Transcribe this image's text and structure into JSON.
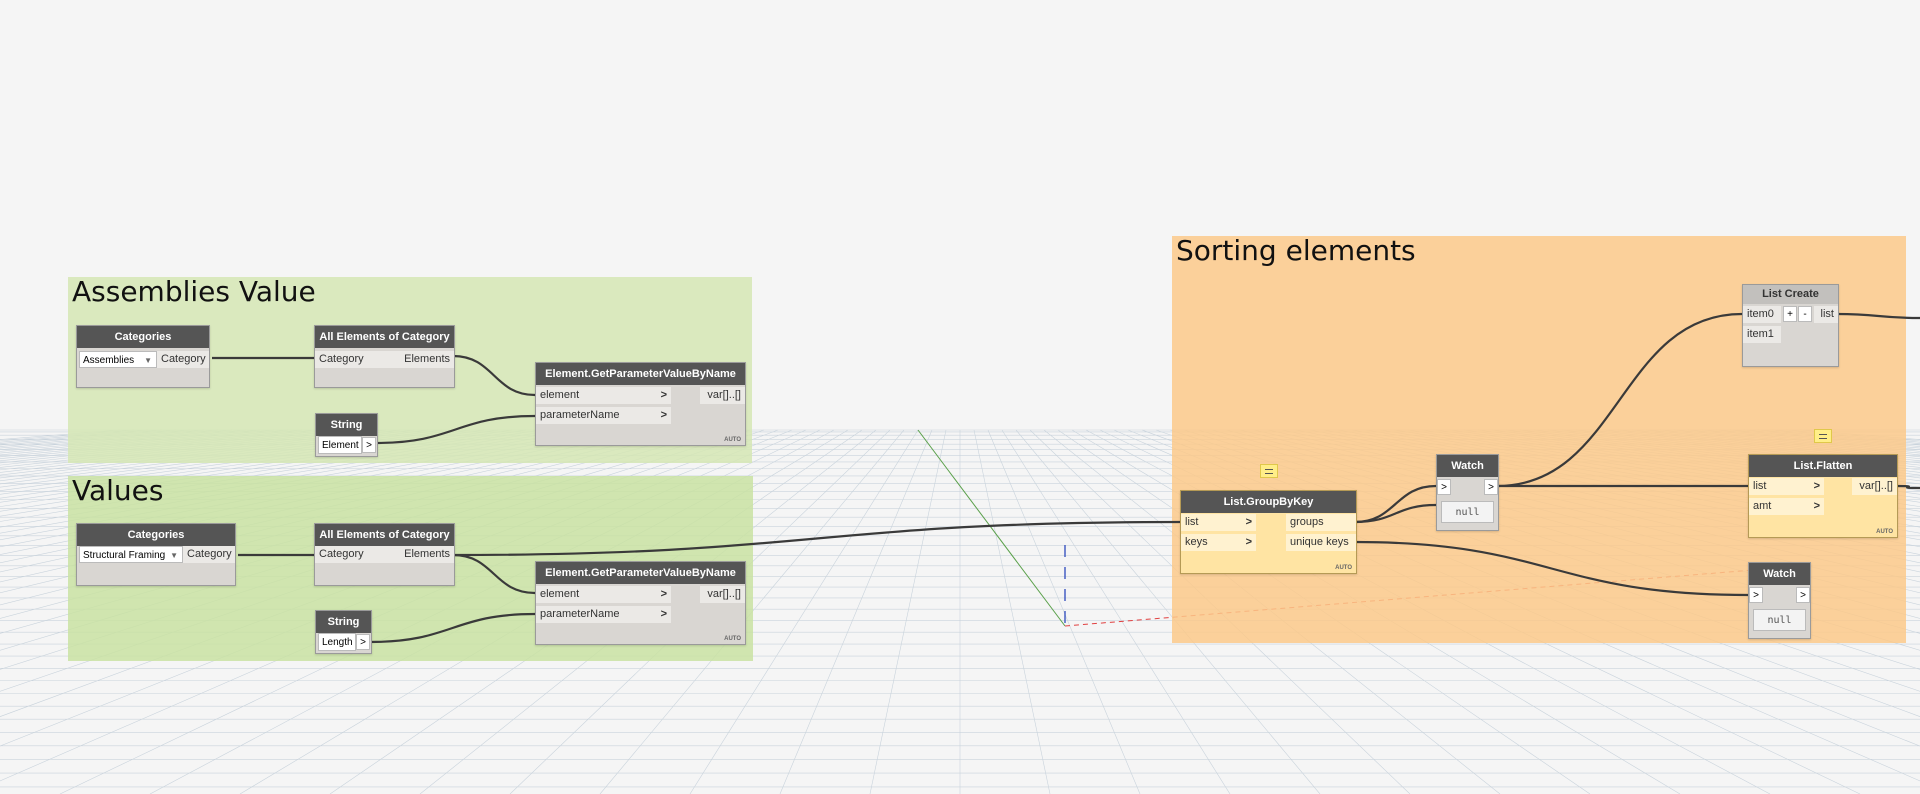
{
  "groups": [
    {
      "title": "Assemblies Value",
      "color": "#d5e6b4"
    },
    {
      "title": "Values",
      "color": "#c9e2a2"
    },
    {
      "title": "Sorting elements",
      "color": "#fbc98a"
    }
  ],
  "nodes": {
    "categories1": {
      "title": "Categories",
      "selected": "Assemblies",
      "output": "Category"
    },
    "allElements1": {
      "title": "All Elements of Category",
      "input": "Category",
      "output": "Elements"
    },
    "string1": {
      "title": "String",
      "value": "Element",
      "output": ">"
    },
    "getParam1": {
      "title": "Element.GetParameterValueByName",
      "inputs": [
        "element",
        "parameterName"
      ],
      "output": "var[]..[]",
      "lacing": "AUTO"
    },
    "categories2": {
      "title": "Categories",
      "selected": "Structural Framing",
      "output": "Category"
    },
    "allElements2": {
      "title": "All Elements of Category",
      "input": "Category",
      "output": "Elements"
    },
    "string2": {
      "title": "String",
      "value": "Length",
      "output": ">"
    },
    "getParam2": {
      "title": "Element.GetParameterValueByName",
      "inputs": [
        "element",
        "parameterName"
      ],
      "output": "var[]..[]",
      "lacing": "AUTO"
    },
    "groupByKey": {
      "title": "List.GroupByKey",
      "inputs": [
        "list",
        "keys"
      ],
      "outputs": [
        "groups",
        "unique keys"
      ],
      "lacing": "AUTO"
    },
    "watch1": {
      "title": "Watch",
      "in": ">",
      "out": ">",
      "value": "null"
    },
    "listCreate": {
      "title": "List Create",
      "inputs": [
        "item0",
        "item1"
      ],
      "plus": "+",
      "minus": "-",
      "output": "list"
    },
    "flatten": {
      "title": "List.Flatten",
      "inputs": [
        "list",
        "amt"
      ],
      "output": "var[]..[]",
      "lacing": "AUTO"
    },
    "watch2": {
      "title": "Watch",
      "in": ">",
      "out": ">",
      "value": "null"
    }
  },
  "icons": {
    "note": "note-icon",
    "arrow": "chevron-right-icon"
  }
}
